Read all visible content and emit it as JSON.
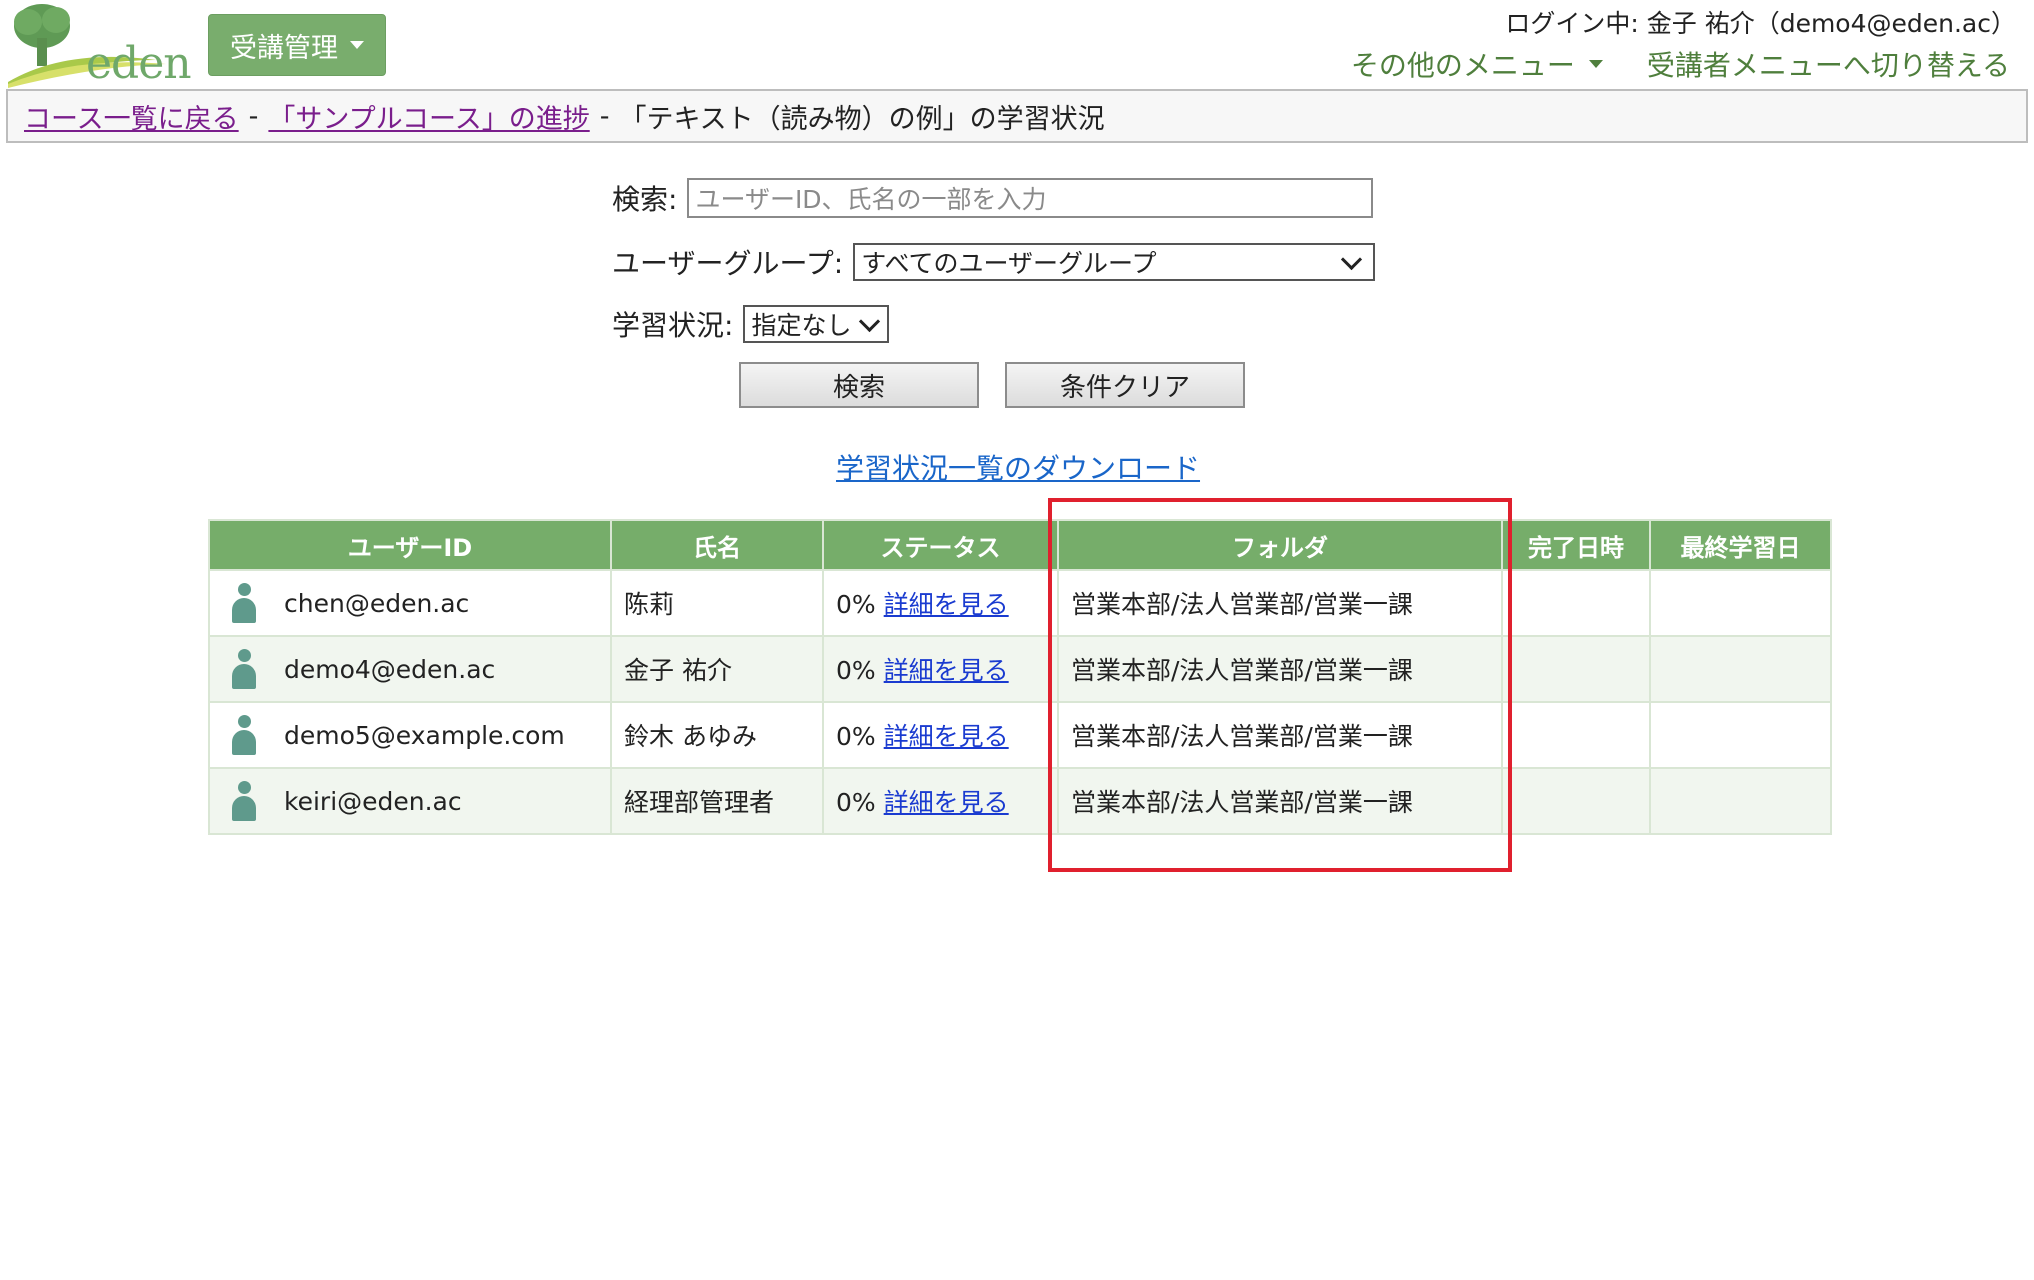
{
  "header": {
    "logo_text": "eden",
    "menu_button_label": "受講管理",
    "login_info": "ログイン中: 金子 祐介（demo4@eden.ac）",
    "other_menu_label": "その他のメニュー",
    "switch_label": "受講者メニューへ切り替える"
  },
  "breadcrumb": {
    "back_link": "コース一覧に戻る",
    "sep1": "-",
    "course_link": "「サンプルコース」の進捗",
    "sep2": "-",
    "current": "「テキスト（読み物）の例」の学習状況"
  },
  "search": {
    "label": "検索:",
    "placeholder": "ユーザーID、氏名の一部を入力",
    "group_label": "ユーザーグループ:",
    "group_value": "すべてのユーザーグループ",
    "status_label": "学習状況:",
    "status_value": "指定なし",
    "search_button": "検索",
    "clear_button": "条件クリア"
  },
  "download_link": "学習状況一覧のダウンロード",
  "table": {
    "headers": [
      "ユーザーID",
      "氏名",
      "ステータス",
      "フォルダ",
      "完了日時",
      "最終学習日"
    ],
    "rows": [
      {
        "user_id": "chen@eden.ac",
        "name": "陈莉",
        "status": "0%",
        "detail": "詳細を見る",
        "folder": "営業本部/法人営業部/営業一課",
        "completed": "",
        "last": ""
      },
      {
        "user_id": "demo4@eden.ac",
        "name": "金子 祐介",
        "status": "0%",
        "detail": "詳細を見る",
        "folder": "営業本部/法人営業部/営業一課",
        "completed": "",
        "last": ""
      },
      {
        "user_id": "demo5@example.com",
        "name": "鈴木 あゆみ",
        "status": "0%",
        "detail": "詳細を見る",
        "folder": "営業本部/法人営業部/営業一課",
        "completed": "",
        "last": ""
      },
      {
        "user_id": "keiri@eden.ac",
        "name": "経理部管理者",
        "status": "0%",
        "detail": "詳細を見る",
        "folder": "営業本部/法人営業部/営業一課",
        "completed": "",
        "last": ""
      }
    ]
  },
  "colors": {
    "brand_green": "#76ad6a",
    "link_purple": "#7a1e8c",
    "link_blue": "#1a66c9",
    "highlight_red": "#e0202e"
  }
}
